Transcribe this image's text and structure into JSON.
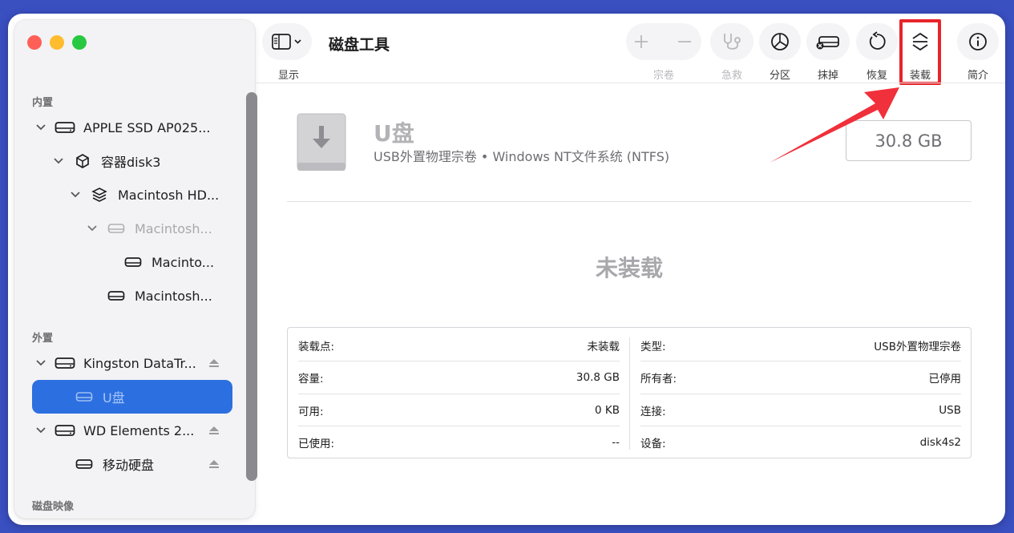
{
  "toolbar": {
    "app_title": "磁盘工具",
    "view_label": "显示",
    "buttons": [
      {
        "key": "volume",
        "label": "宗卷",
        "enabled": false
      },
      {
        "key": "first_aid",
        "label": "急救",
        "enabled": false
      },
      {
        "key": "partition",
        "label": "分区",
        "enabled": true
      },
      {
        "key": "erase",
        "label": "抹掉",
        "enabled": true
      },
      {
        "key": "restore",
        "label": "恢复",
        "enabled": true
      },
      {
        "key": "mount",
        "label": "装载",
        "enabled": true
      },
      {
        "key": "info",
        "label": "简介",
        "enabled": true
      }
    ]
  },
  "sidebar": {
    "internal_label": "内置",
    "external_label": "外置",
    "disk_images_label": "磁盘映像",
    "internal_items": [
      {
        "label": "APPLE SSD AP025...",
        "icon": "drive-icon"
      },
      {
        "label": "容器disk3",
        "icon": "container-icon"
      },
      {
        "label": "Macintosh HD...",
        "icon": "layers-icon"
      },
      {
        "label": "Macintosh...",
        "icon": "drive-icon"
      },
      {
        "label": "Macinto...",
        "icon": "drive-icon"
      },
      {
        "label": "Macintosh...",
        "icon": "drive-icon"
      }
    ],
    "external_items": [
      {
        "label": "Kingston DataTr...",
        "icon": "drive-icon"
      },
      {
        "label": "U盘",
        "icon": "drive-icon"
      },
      {
        "label": "WD Elements 2...",
        "icon": "drive-icon"
      },
      {
        "label": "移动硬盘",
        "icon": "drive-icon"
      }
    ]
  },
  "volume": {
    "name": "U盘",
    "description": "USB外置物理宗卷 • Windows NT文件系统 (NTFS)",
    "size": "30.8 GB",
    "status": "未装载"
  },
  "info": {
    "left": [
      {
        "label": "装载点:",
        "value": "未装载"
      },
      {
        "label": "容量:",
        "value": "30.8 GB"
      },
      {
        "label": "可用:",
        "value": "0 KB"
      },
      {
        "label": "已使用:",
        "value": "--"
      }
    ],
    "right": [
      {
        "label": "类型:",
        "value": "USB外置物理宗卷"
      },
      {
        "label": "所有者:",
        "value": "已停用"
      },
      {
        "label": "连接:",
        "value": "USB"
      },
      {
        "label": "设备:",
        "value": "disk4s2"
      }
    ]
  },
  "colors": {
    "background": "#3a4fc0",
    "selection": "#2c6fe0",
    "highlight": "#e8242b"
  }
}
